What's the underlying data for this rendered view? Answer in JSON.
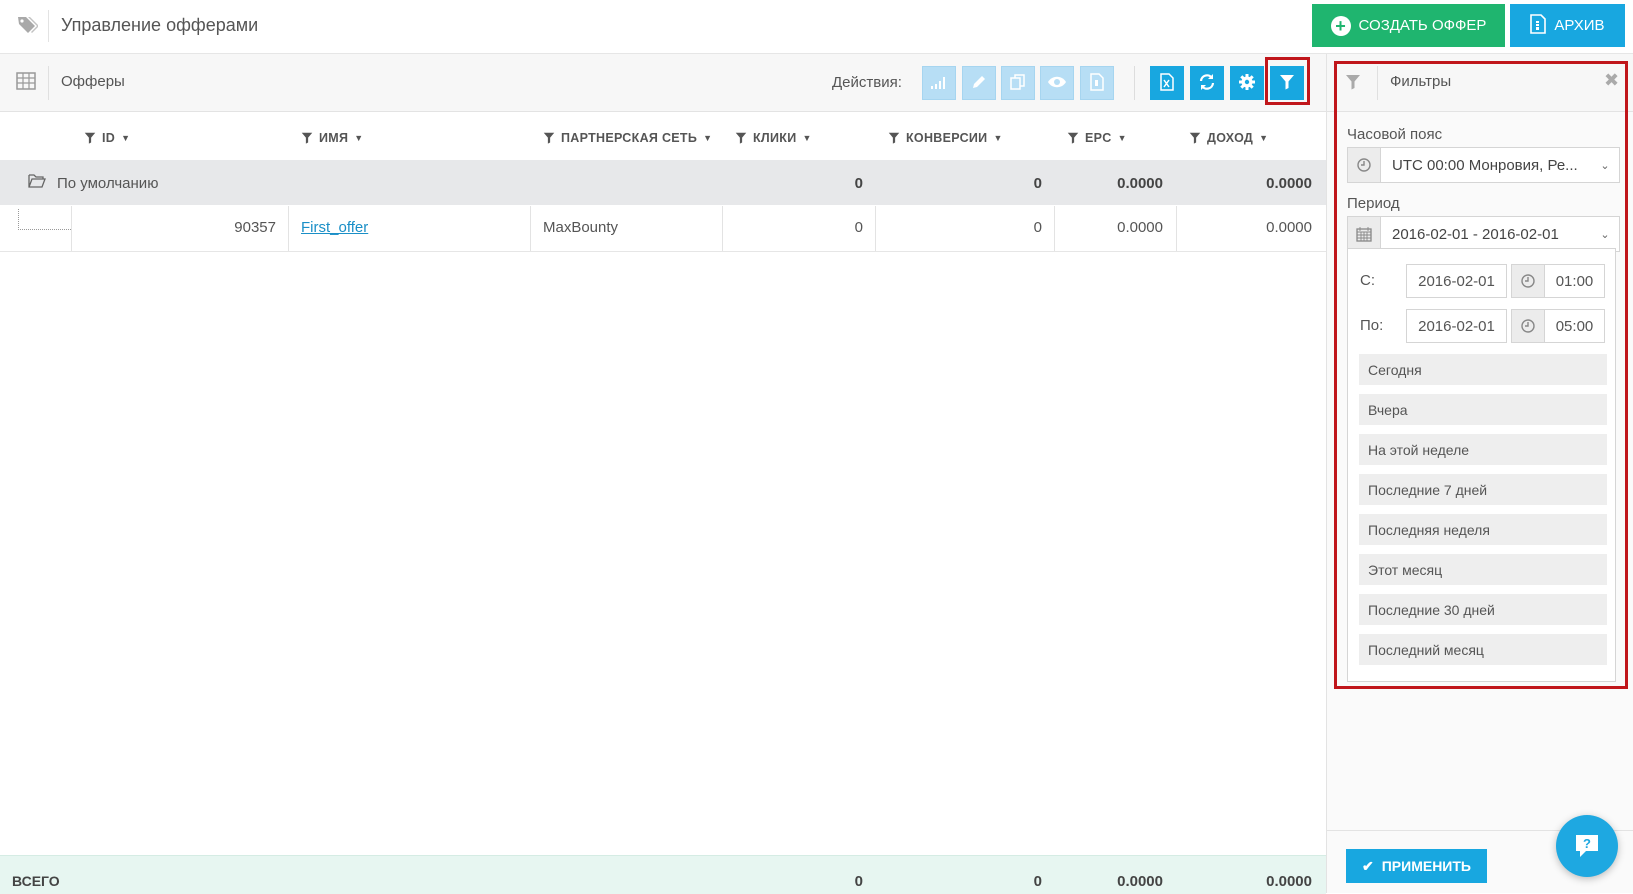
{
  "header": {
    "title": "Управление офферами",
    "create_label": "СОЗДАТЬ ОФФЕР",
    "archive_label": "АРХИВ"
  },
  "toolbar": {
    "title": "Офферы",
    "actions_label": "Действия:",
    "icons": [
      "bar-chart-icon",
      "pencil-icon",
      "copy-icon",
      "eye-icon",
      "file-icon",
      "excel-icon",
      "refresh-icon",
      "gear-icon",
      "filter-icon"
    ]
  },
  "table": {
    "columns": [
      "ID",
      "ИМЯ",
      "ПАРТНЕРСКАЯ СЕТЬ",
      "КЛИКИ",
      "КОНВЕРСИИ",
      "EPC",
      "ДОХОД"
    ],
    "group": {
      "name": "По умолчанию",
      "clicks": "0",
      "conversions": "0",
      "epc": "0.0000",
      "revenue": "0.0000"
    },
    "rows": [
      {
        "id": "90357",
        "name": "First_offer",
        "network": "MaxBounty",
        "clicks": "0",
        "conversions": "0",
        "epc": "0.0000",
        "revenue": "0.0000"
      }
    ],
    "footer": {
      "label": "ВСЕГО",
      "clicks": "0",
      "conversions": "0",
      "epc": "0.0000",
      "revenue": "0.0000"
    }
  },
  "filters": {
    "title": "Фильтры",
    "timezone_label": "Часовой пояс",
    "timezone_value": "UTC 00:00 Монровия, Ре...",
    "period_label": "Период",
    "period_value": "2016-02-01 - 2016-02-01",
    "from_label": "С:",
    "from_date": "2016-02-01",
    "from_time": "01:00",
    "to_label": "По:",
    "to_date": "2016-02-01",
    "to_time": "05:00",
    "presets": [
      "Сегодня",
      "Вчера",
      "На этой неделе",
      "Последние 7 дней",
      "Последняя неделя",
      "Этот месяц",
      "Последние 30 дней",
      "Последний месяц"
    ],
    "apply_label": "ПРИМЕНИТЬ"
  },
  "colors": {
    "green": "#1fb56f",
    "blue": "#18a7e0",
    "highlight": "#c0161b",
    "link": "#1a8fc7"
  }
}
